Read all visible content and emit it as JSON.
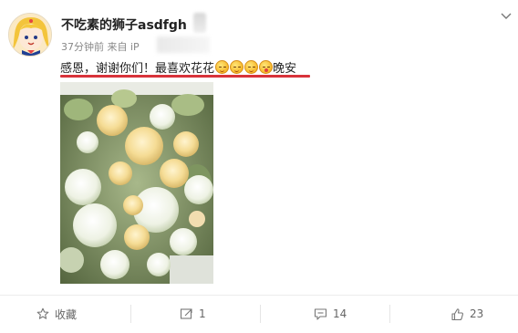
{
  "user": {
    "name": "不吃素的狮子asdfgh",
    "meta_time": "37分钟前 来自 iP"
  },
  "post": {
    "text_before": "感恩，谢谢你们！最喜欢花花",
    "text_after": "晚安",
    "emojis": [
      "smile-emoji",
      "smile-emoji",
      "smile-emoji",
      "kiss-emoji"
    ]
  },
  "actions": {
    "favorite_label": "收藏",
    "repost_count": "1",
    "comment_count": "14",
    "like_count": "23"
  },
  "colors": {
    "underline": "#d8333a",
    "text": "#222222",
    "meta": "#888888"
  }
}
